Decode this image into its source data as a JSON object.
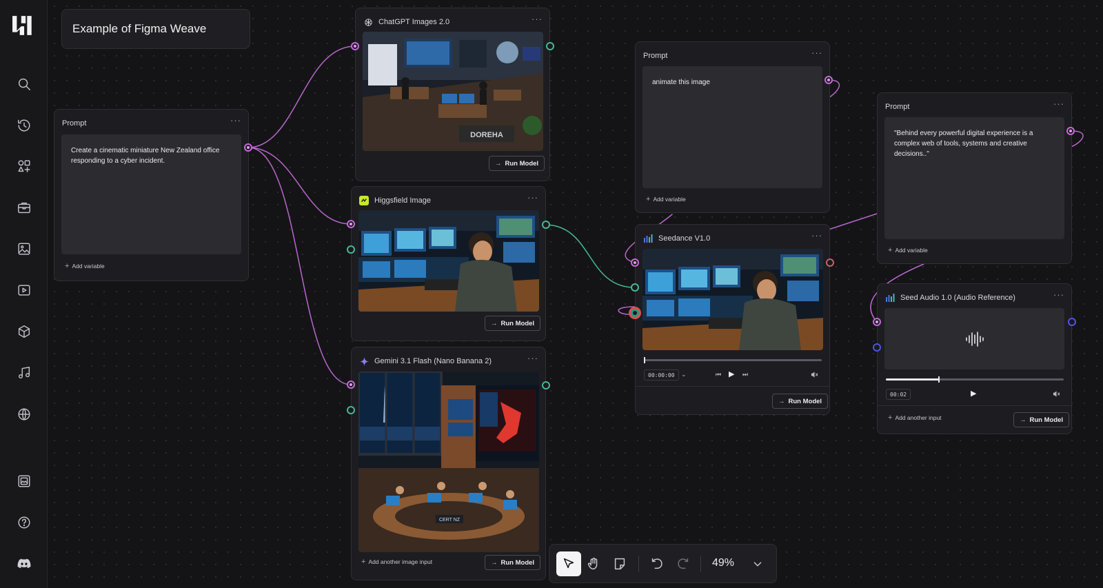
{
  "canvas_title": "Example of Figma Weave",
  "sidebar": {
    "icons": [
      "weave-logo-icon",
      "search-icon",
      "history-icon",
      "add-shapes-icon",
      "toolbox-icon",
      "image-icon",
      "video-icon",
      "3d-cube-icon",
      "music-icon",
      "globe-icon",
      "gallery-icon",
      "help-icon",
      "discord-icon"
    ]
  },
  "nodes": {
    "prompt_main": {
      "title": "Prompt",
      "menu": "···",
      "text": "Create a cinematic miniature New Zealand office responding to a cyber incident.",
      "add_variable": "Add variable"
    },
    "chatgpt": {
      "title": "ChatGPT Images 2.0",
      "menu": "···",
      "run": "Run Model",
      "image_caption": "DOREHA"
    },
    "higgsfield": {
      "title": "Higgsfield Image",
      "menu": "···",
      "run": "Run Model"
    },
    "gemini": {
      "title": "Gemini 3.1 Flash (Nano Banana 2)",
      "menu": "···",
      "run": "Run Model",
      "add_input": "Add another image input",
      "image_caption": "CERT NZ"
    },
    "prompt_animate": {
      "title": "Prompt",
      "menu": "···",
      "text": "animate this image",
      "add_variable": "Add variable"
    },
    "seedance": {
      "title": "Seedance V1.0",
      "menu": "···",
      "time": "00:00:00",
      "run": "Run Model",
      "progress": 0
    },
    "prompt_quote": {
      "title": "Prompt",
      "menu": "···",
      "text": "\"Behind every powerful digital experience is a complex web of tools, systems and creative decisions..\"",
      "add_variable": "Add variable"
    },
    "seed_audio": {
      "title": "Seed Audio 1.0 (Audio Reference)",
      "menu": "···",
      "time": "00:02",
      "add_input": "Add another input",
      "run": "Run Model",
      "progress": 0.3
    }
  },
  "toolbar": {
    "tools": [
      "pointer-tool",
      "hand-tool",
      "note-tool"
    ],
    "active_tool": "pointer-tool",
    "zoom": "49%"
  },
  "colors": {
    "text_port": "#c56ad8",
    "image_port": "#46b894",
    "audio_port": "#4d55e0",
    "canvas_bg": "#141417"
  }
}
